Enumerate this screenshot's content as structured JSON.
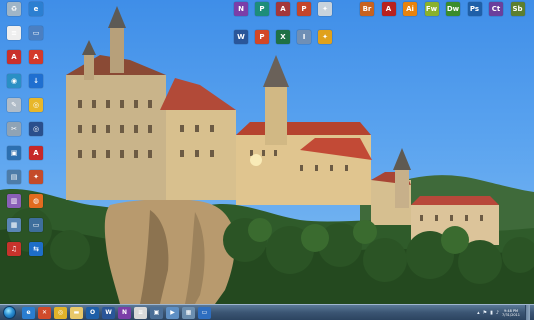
{
  "desktop": {
    "wallpaper": "castle-on-cliff",
    "left_icons": [
      {
        "name": "recycle-bin-icon",
        "label": "",
        "color": "#9fb5c7",
        "glyph": "♻"
      },
      {
        "name": "ie-shortcut-icon",
        "label": "",
        "color": "#2c7fd1",
        "glyph": "e"
      },
      {
        "name": "document-icon",
        "label": "",
        "color": "#eeeeee",
        "glyph": "≡"
      },
      {
        "name": "computer-icon",
        "label": "",
        "color": "#4b7fc1",
        "glyph": "▭"
      },
      {
        "name": "pdf-icon",
        "label": "",
        "color": "#c9302c",
        "glyph": "A"
      },
      {
        "name": "acrobat-icon",
        "label": "",
        "color": "#d33a2b",
        "glyph": "A"
      },
      {
        "name": "network-icon",
        "label": "",
        "color": "#2a8fc4",
        "glyph": "◉"
      },
      {
        "name": "download-icon",
        "label": "",
        "color": "#1f6fd0",
        "glyph": "↓"
      },
      {
        "name": "settings-icon",
        "label": "",
        "color": "#b0bcc8",
        "glyph": "✎"
      },
      {
        "name": "chrome-icon",
        "label": "",
        "color": "#e8b729",
        "glyph": "◎"
      },
      {
        "name": "tool-icon",
        "label": "",
        "color": "#8fa3b5",
        "glyph": "✂"
      },
      {
        "name": "disc-icon",
        "label": "",
        "color": "#2a4f8c",
        "glyph": "◎"
      },
      {
        "name": "app-icon",
        "label": "",
        "color": "#2c6fb0",
        "glyph": "▣"
      },
      {
        "name": "pdf-reader-icon",
        "label": "",
        "color": "#c62828",
        "glyph": "A"
      },
      {
        "name": "screen-icon",
        "label": "",
        "color": "#4d7ca8",
        "glyph": "▤"
      },
      {
        "name": "paint-icon",
        "label": "",
        "color": "#c44b2a",
        "glyph": "✦"
      },
      {
        "name": "notebook-icon",
        "label": "",
        "color": "#8a5fb8",
        "glyph": "▥"
      },
      {
        "name": "firefox-icon",
        "label": "",
        "color": "#e26b1f",
        "glyph": "◍"
      },
      {
        "name": "chart-icon",
        "label": "",
        "color": "#5a86b5",
        "glyph": "▦"
      },
      {
        "name": "monitor-icon",
        "label": "",
        "color": "#3e6e9c",
        "glyph": "▭"
      },
      {
        "name": "music-icon",
        "label": "",
        "color": "#c7332c",
        "glyph": "♫"
      },
      {
        "name": "teamviewer-icon",
        "label": "",
        "color": "#1e6ec8",
        "glyph": "⇆"
      }
    ],
    "top_icons_mid": [
      {
        "name": "onenote-icon",
        "label": "",
        "color": "#7b3ea8",
        "glyph": "N"
      },
      {
        "name": "publisher-icon",
        "label": "",
        "color": "#1d8d7a",
        "glyph": "P"
      },
      {
        "name": "access-icon",
        "label": "",
        "color": "#a4373a",
        "glyph": "A"
      },
      {
        "name": "powerpoint-icon",
        "label": "",
        "color": "#c4452b",
        "glyph": "P"
      },
      {
        "name": "tools-icon",
        "label": "",
        "color": "#c8d3dc",
        "glyph": "✦"
      },
      {
        "name": "word-icon",
        "label": "",
        "color": "#2a5699",
        "glyph": "W"
      },
      {
        "name": "powerpoint2-icon",
        "label": "",
        "color": "#d24726",
        "glyph": "P"
      },
      {
        "name": "excel-icon",
        "label": "",
        "color": "#1e7145",
        "glyph": "X"
      },
      {
        "name": "infopath-icon",
        "label": "",
        "color": "#6f8fb5",
        "glyph": "I"
      },
      {
        "name": "sharepoint-icon",
        "label": "",
        "color": "#e0a11b",
        "glyph": "✦"
      }
    ],
    "top_icons_right": [
      {
        "name": "bridge-icon",
        "label": "",
        "color": "#c8621f",
        "glyph": "Br"
      },
      {
        "name": "acrobat-pro-icon",
        "label": "",
        "color": "#b8211f",
        "glyph": "A"
      },
      {
        "name": "illustrator-icon",
        "label": "",
        "color": "#e7830e",
        "glyph": "Ai"
      },
      {
        "name": "fireworks-icon",
        "label": "",
        "color": "#8ab12c",
        "glyph": "Fw"
      },
      {
        "name": "dreamweaver-icon",
        "label": "",
        "color": "#3a8c2c",
        "glyph": "Dw"
      },
      {
        "name": "photoshop-icon",
        "label": "",
        "color": "#1e5fa8",
        "glyph": "Ps"
      },
      {
        "name": "contribute-icon",
        "label": "",
        "color": "#6b3f9c",
        "glyph": "Ct"
      },
      {
        "name": "soundbooth-icon",
        "label": "",
        "color": "#5d7f2f",
        "glyph": "Sb"
      }
    ]
  },
  "taskbar": {
    "items": [
      {
        "name": "taskbar-ie-icon",
        "color": "#2a7dd0",
        "glyph": "e"
      },
      {
        "name": "taskbar-x-icon",
        "color": "#d04a2a",
        "glyph": "✕"
      },
      {
        "name": "taskbar-chrome-icon",
        "color": "#e0b32a",
        "glyph": "◎"
      },
      {
        "name": "taskbar-explorer-icon",
        "color": "#e8c86a",
        "glyph": "▬"
      },
      {
        "name": "taskbar-outlook-icon",
        "color": "#1e5fa8",
        "glyph": "O"
      },
      {
        "name": "taskbar-word-icon",
        "color": "#2a5699",
        "glyph": "W"
      },
      {
        "name": "taskbar-onenote-icon",
        "color": "#7b3ea8",
        "glyph": "N"
      },
      {
        "name": "taskbar-notepad-icon",
        "color": "#d9d9d9",
        "glyph": "≡"
      },
      {
        "name": "taskbar-app-icon",
        "color": "#4b6e96",
        "glyph": "▣"
      },
      {
        "name": "taskbar-media-icon",
        "color": "#5e8fc4",
        "glyph": "▶"
      },
      {
        "name": "taskbar-picture-icon",
        "color": "#6c8fb0",
        "glyph": "▦"
      },
      {
        "name": "taskbar-window-icon",
        "color": "#2e6ec0",
        "glyph": "▭"
      }
    ],
    "tray": {
      "clock_time": "9:48 PM",
      "clock_date": "7/31/2011"
    }
  }
}
